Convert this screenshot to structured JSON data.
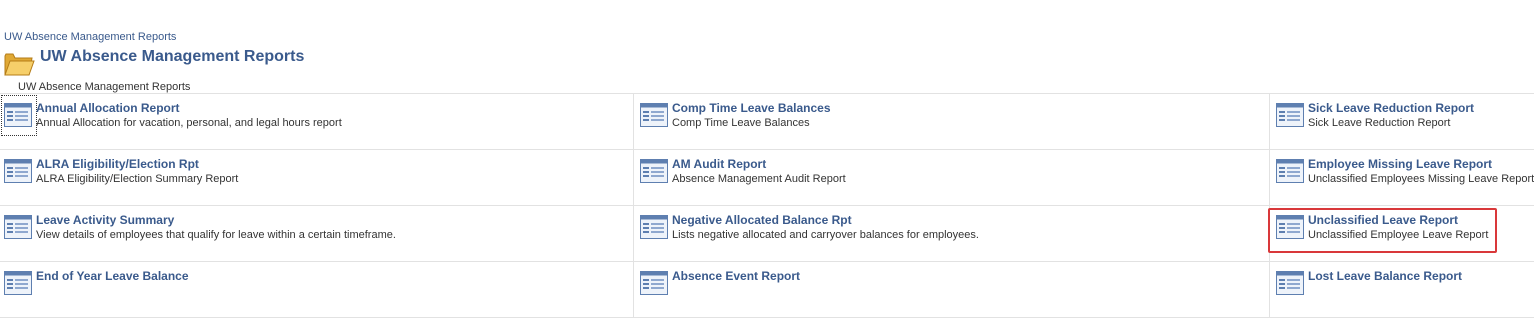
{
  "breadcrumb": "UW Absence Management Reports",
  "page_title": "UW Absence Management Reports",
  "subtitle": "UW Absence Management Reports",
  "colors": {
    "link": "#3a5a8c",
    "highlight": "#d9383a",
    "divider": "#e2e2e2"
  },
  "reports": [
    {
      "title": "Annual Allocation Report",
      "desc": "Annual Allocation for vacation, personal, and legal hours report"
    },
    {
      "title": "Comp Time Leave Balances",
      "desc": "Comp Time Leave Balances"
    },
    {
      "title": "Sick Leave Reduction Report",
      "desc": "Sick Leave Reduction Report"
    },
    {
      "title": "ALRA Eligibility/Election Rpt",
      "desc": "ALRA Eligibility/Election Summary Report"
    },
    {
      "title": "AM Audit Report",
      "desc": "Absence Management Audit Report"
    },
    {
      "title": "Employee Missing Leave Report",
      "desc": "Unclassified Employees Missing Leave Report"
    },
    {
      "title": "Leave Activity Summary",
      "desc": "View details of employees that qualify for leave within a certain timeframe."
    },
    {
      "title": "Negative Allocated Balance Rpt",
      "desc": "Lists negative allocated and carryover balances for employees."
    },
    {
      "title": "Unclassified Leave Report",
      "desc": "Unclassified Employee Leave Report"
    },
    {
      "title": "End of Year Leave Balance",
      "desc": ""
    },
    {
      "title": "Absence Event Report",
      "desc": ""
    },
    {
      "title": "Lost Leave Balance Report",
      "desc": ""
    }
  ]
}
